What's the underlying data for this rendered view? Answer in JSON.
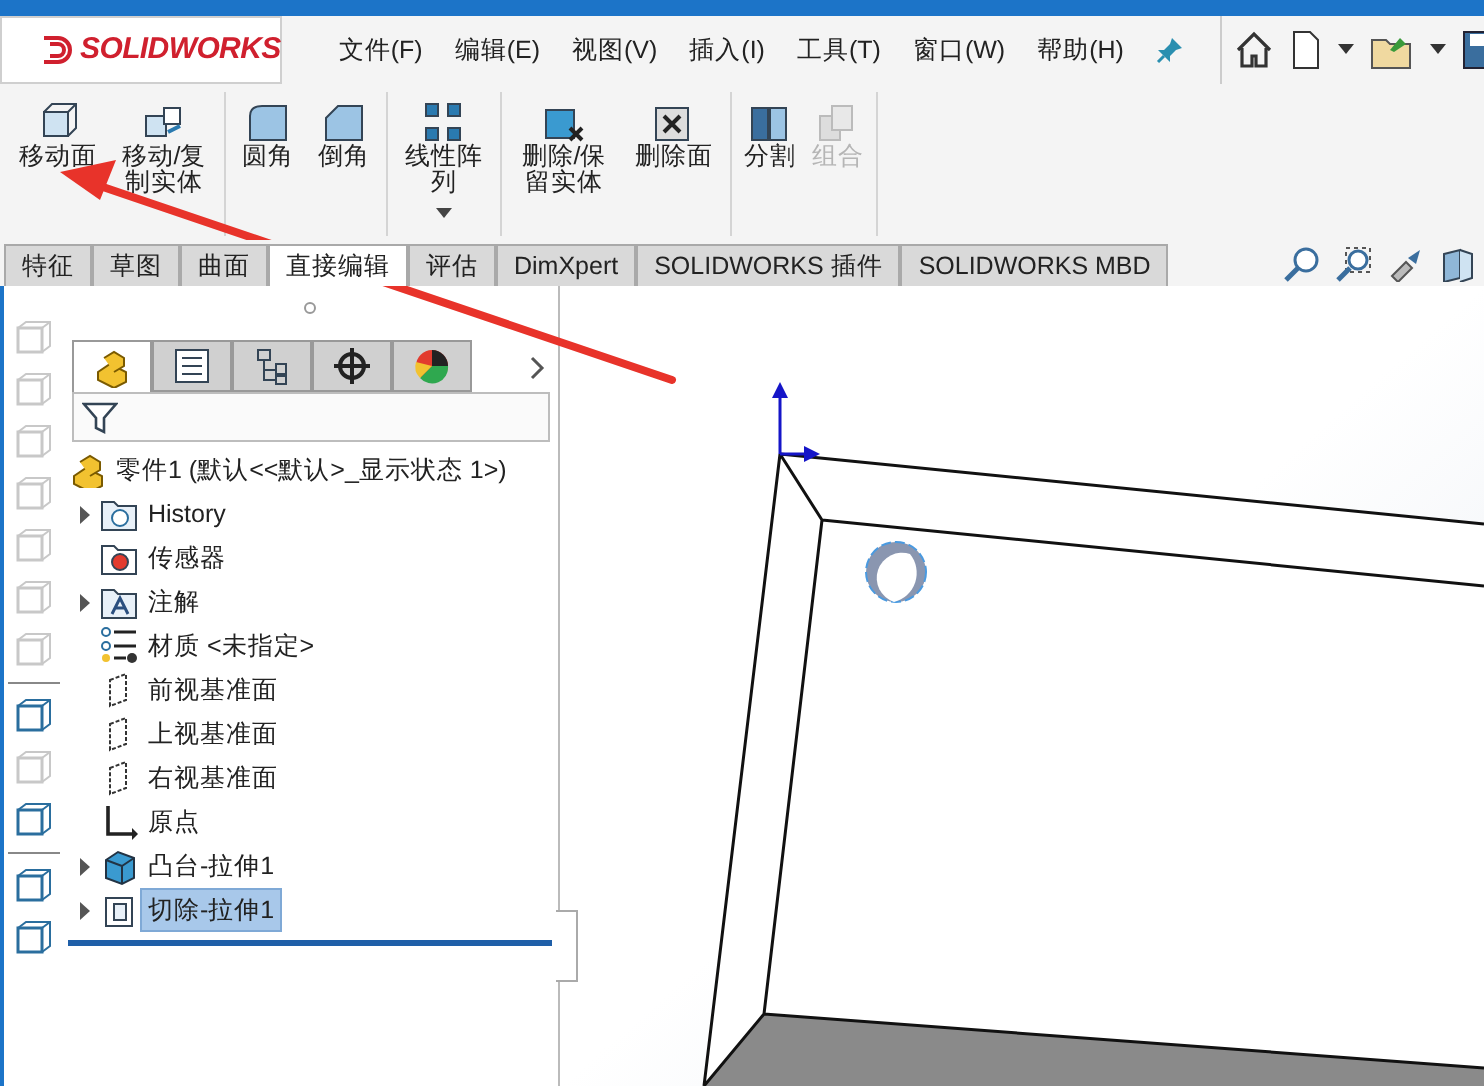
{
  "logo": {
    "text": "SOLIDWORKS"
  },
  "menu": [
    "文件(F)",
    "编辑(E)",
    "视图(V)",
    "插入(I)",
    "工具(T)",
    "窗口(W)",
    "帮助(H)"
  ],
  "ribbon_groups": [
    {
      "buttons": [
        {
          "label": "移动面",
          "kind": "move-face",
          "disabled": false
        },
        {
          "label": "移动/复制实体",
          "kind": "move-copy",
          "disabled": false
        }
      ]
    },
    {
      "buttons": [
        {
          "label": "圆角",
          "kind": "fillet",
          "disabled": false
        },
        {
          "label": "倒角",
          "kind": "chamfer",
          "disabled": false
        }
      ]
    },
    {
      "buttons": [
        {
          "label": "线性阵列",
          "kind": "pattern",
          "disabled": false,
          "dropdown": true
        }
      ]
    },
    {
      "buttons": [
        {
          "label": "删除/保留实体",
          "kind": "delete-body",
          "disabled": false
        },
        {
          "label": "删除面",
          "kind": "delete-face",
          "disabled": false
        }
      ]
    },
    {
      "buttons": [
        {
          "label": "分割",
          "kind": "split",
          "disabled": false
        },
        {
          "label": "组合",
          "kind": "combine",
          "disabled": true
        }
      ]
    }
  ],
  "tabs": [
    {
      "label": "特征",
      "selected": false
    },
    {
      "label": "草图",
      "selected": false
    },
    {
      "label": "曲面",
      "selected": false
    },
    {
      "label": "直接编辑",
      "selected": true
    },
    {
      "label": "评估",
      "selected": false
    },
    {
      "label": "DimXpert",
      "selected": false
    },
    {
      "label": "SOLIDWORKS 插件",
      "selected": false
    },
    {
      "label": "SOLIDWORKS MBD",
      "selected": false
    }
  ],
  "left_toolbar": [
    {
      "disabled": true
    },
    {
      "disabled": true
    },
    {
      "disabled": true
    },
    {
      "disabled": true
    },
    {
      "disabled": true
    },
    {
      "disabled": true
    },
    {
      "disabled": true
    },
    {
      "disabled": false
    },
    {
      "disabled": true
    },
    {
      "disabled": false
    },
    {
      "disabled": false
    },
    {
      "disabled": false
    }
  ],
  "panel_tabs": [
    {
      "kind": "feature",
      "selected": true
    },
    {
      "kind": "property",
      "selected": false
    },
    {
      "kind": "config",
      "selected": false
    },
    {
      "kind": "dim",
      "selected": false
    },
    {
      "kind": "display",
      "selected": false
    }
  ],
  "tree": {
    "root": "零件1  (默认<<默认>_显示状态 1>)",
    "items": [
      {
        "label": "History",
        "kind": "history",
        "expander": true,
        "selected": false
      },
      {
        "label": "传感器",
        "kind": "sensor",
        "expander": false,
        "selected": false
      },
      {
        "label": "注解",
        "kind": "annotation",
        "expander": true,
        "selected": false
      },
      {
        "label": "材质 <未指定>",
        "kind": "material",
        "expander": false,
        "selected": false
      },
      {
        "label": "前视基准面",
        "kind": "plane",
        "expander": false,
        "selected": false
      },
      {
        "label": "上视基准面",
        "kind": "plane",
        "expander": false,
        "selected": false
      },
      {
        "label": "右视基准面",
        "kind": "plane",
        "expander": false,
        "selected": false
      },
      {
        "label": "原点",
        "kind": "origin",
        "expander": false,
        "selected": false
      },
      {
        "label": "凸台-拉伸1",
        "kind": "boss",
        "expander": true,
        "selected": false
      },
      {
        "label": "切除-拉伸1",
        "kind": "cut",
        "expander": true,
        "selected": true
      }
    ]
  }
}
